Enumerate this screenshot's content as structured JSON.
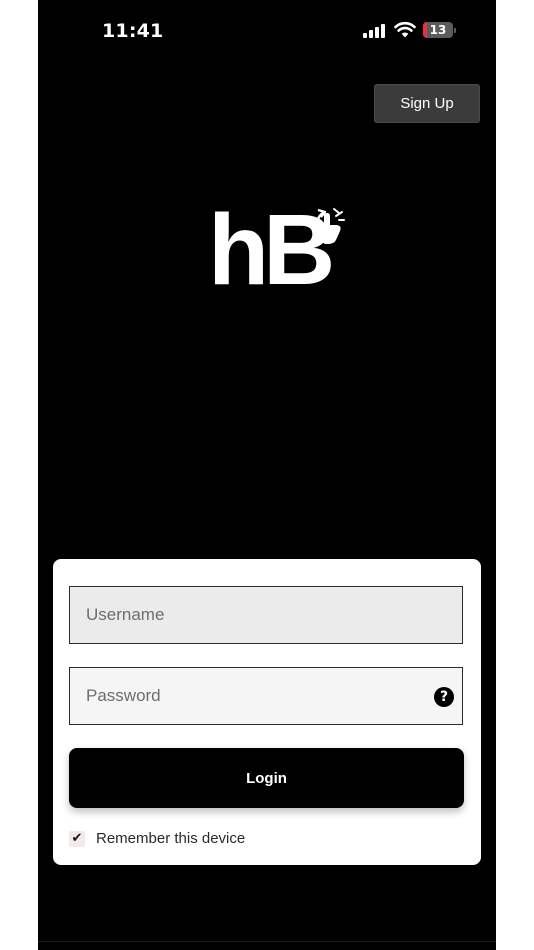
{
  "status_bar": {
    "time": "11:41",
    "battery": "13",
    "battery_level": 0.13
  },
  "header": {
    "signup_label": "Sign Up"
  },
  "logo": {
    "text": "hB"
  },
  "login_form": {
    "username_placeholder": "Username",
    "password_placeholder": "Password",
    "help_icon": "?",
    "login_label": "Login",
    "remember_label": "Remember this device",
    "remember_checked": true,
    "checkmark": "✔"
  },
  "colors": {
    "background": "#000000",
    "card": "#ffffff",
    "signup_button": "#3b3b3b",
    "battery_low": "#e8313a"
  }
}
